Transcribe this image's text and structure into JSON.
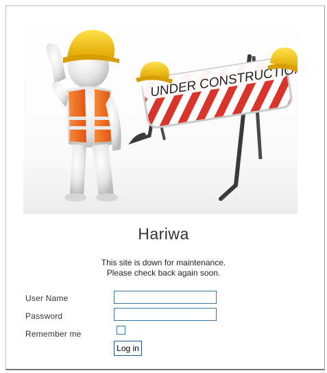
{
  "hero": {
    "sign_text": "UNDER CONSTRUCTION"
  },
  "site": {
    "title": "Hariwa"
  },
  "maintenance": {
    "line1": "This site is down for maintenance.",
    "line2": "Please check back again soon."
  },
  "login_form": {
    "username_label": "User Name",
    "username_value": "",
    "password_label": "Password",
    "password_value": "",
    "remember_label": "Remember me",
    "remember_checked": false,
    "submit_label": "Log in"
  },
  "colors": {
    "input_border": "#3c78a8",
    "hard_hat": "#f2c200",
    "vest": "#f26a1b",
    "barrier_stripe": "#d8342a"
  }
}
